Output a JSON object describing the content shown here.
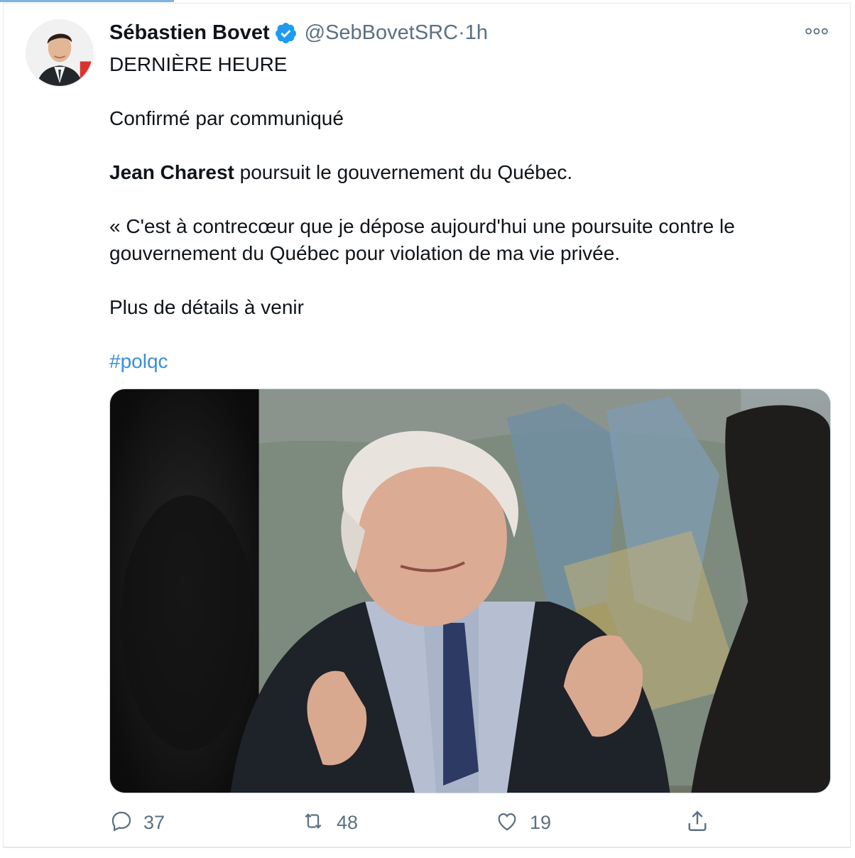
{
  "tweet": {
    "author_name": "Sébastien Bovet",
    "author_handle": "@SebBovetSRC",
    "separator": " · ",
    "time": "1h",
    "lines": {
      "l1": "DERNIÈRE HEURE",
      "l2": "Confirmé par communiqué",
      "l3_bold": "Jean Charest",
      "l3_rest": " poursuit le gouvernement du Québec.",
      "l4": "« C'est à contrecœur que je dépose aujourd'hui une poursuite contre le gouvernement du Québec pour violation de ma vie privée.",
      "l5": "Plus de détails à venir",
      "hashtag": "#polqc"
    },
    "actions": {
      "replies": "37",
      "retweets": "48",
      "likes": "19"
    }
  },
  "colors": {
    "verified": "#1d9bf0",
    "link": "#3a8fd8",
    "secondary": "#5b7083"
  },
  "icons": [
    "verified-badge-icon",
    "more-options-icon",
    "reply-icon",
    "retweet-icon",
    "like-icon",
    "share-icon"
  ]
}
